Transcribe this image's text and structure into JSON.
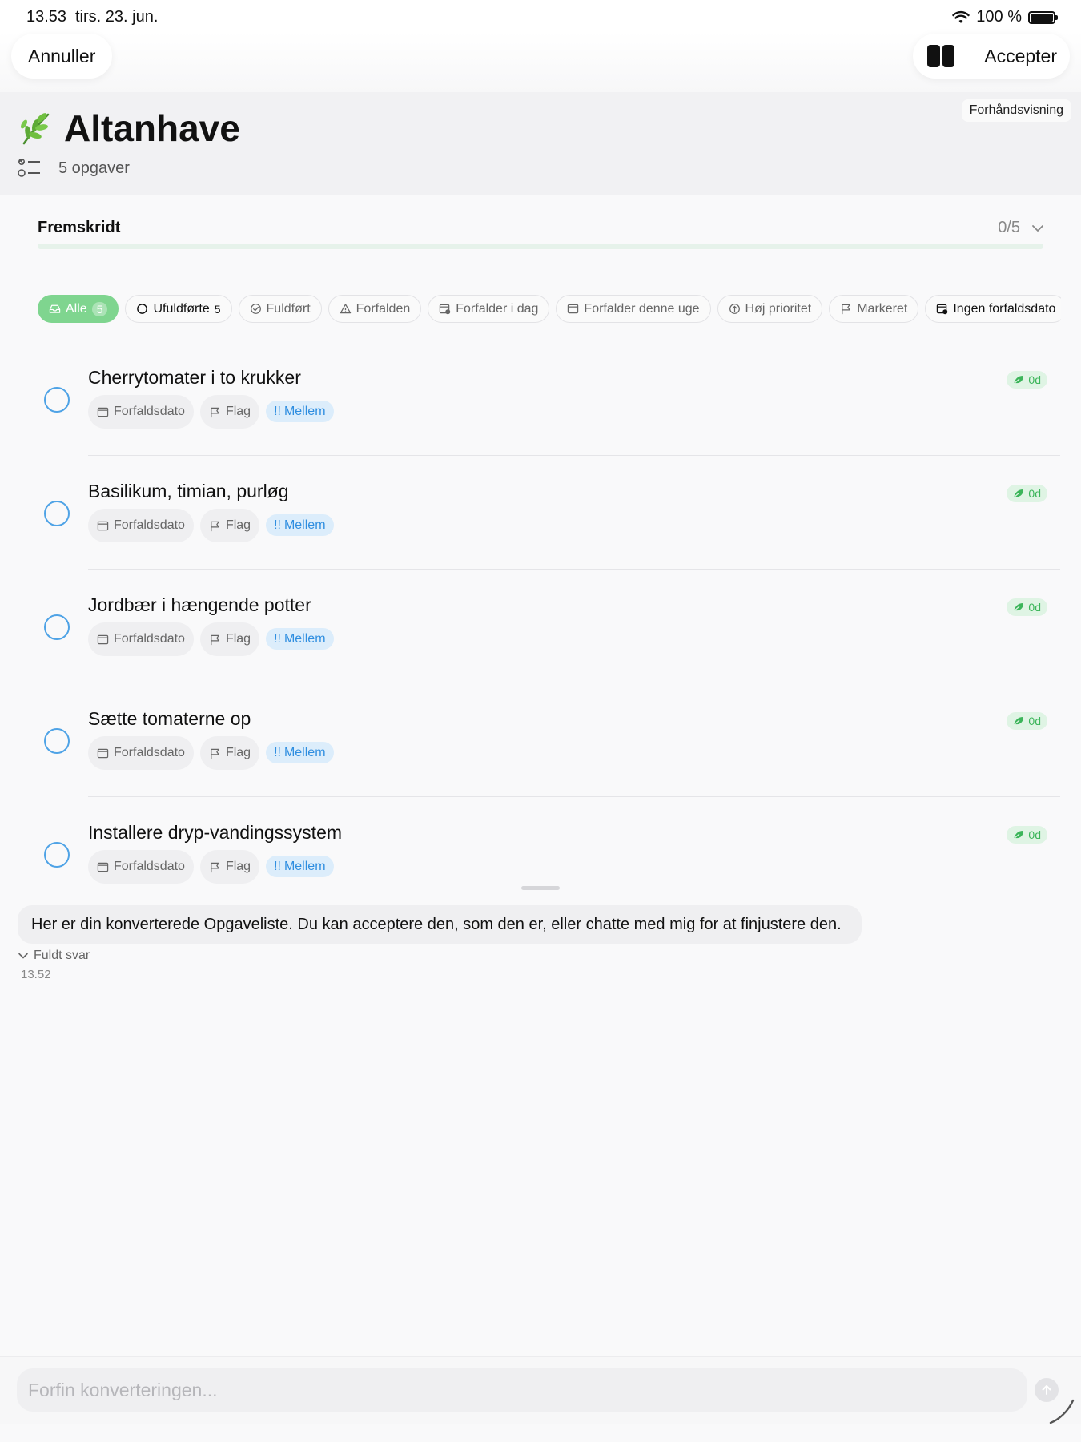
{
  "status_bar": {
    "time": "13.53",
    "date": "tirs. 23. jun.",
    "battery": "100 %"
  },
  "top_bar": {
    "cancel_label": "Annuller",
    "accept_label": "Accepter"
  },
  "header": {
    "preview_badge": "Forhåndsvisning",
    "title": "Altanhave",
    "task_count": "5 opgaver"
  },
  "progress": {
    "label": "Fremskridt",
    "value_text": "0/5",
    "completed": 0,
    "total": 5
  },
  "filters": [
    {
      "label": "Alle",
      "count": "5",
      "icon": "tray-icon",
      "active": true
    },
    {
      "label": "Ufuldførte",
      "count": "5",
      "icon": "circle-icon",
      "active": false
    },
    {
      "label": "Fuldført",
      "count": "",
      "icon": "check-circle-icon",
      "active": false
    },
    {
      "label": "Forfalden",
      "count": "",
      "icon": "warning-icon",
      "active": false
    },
    {
      "label": "Forfalder i dag",
      "count": "",
      "icon": "calendar-clock-icon",
      "active": false
    },
    {
      "label": "Forfalder denne uge",
      "count": "",
      "icon": "calendar-icon",
      "active": false
    },
    {
      "label": "Høj prioritet",
      "count": "",
      "icon": "priority-up-icon",
      "active": false
    },
    {
      "label": "Markeret",
      "count": "",
      "icon": "flag-icon",
      "active": false
    },
    {
      "label": "Ingen forfaldsdato",
      "count": "",
      "icon": "calendar-x-icon",
      "active": false
    }
  ],
  "tasks": [
    {
      "title": "Cherrytomater i to krukker",
      "due_label": "Forfaldsdato",
      "flag_label": "Flag",
      "priority_label": "Mellem",
      "priority_marker": "!!",
      "duration": "0d"
    },
    {
      "title": "Basilikum, timian, purløg",
      "due_label": "Forfaldsdato",
      "flag_label": "Flag",
      "priority_label": "Mellem",
      "priority_marker": "!!",
      "duration": "0d"
    },
    {
      "title": "Jordbær i hængende potter",
      "due_label": "Forfaldsdato",
      "flag_label": "Flag",
      "priority_label": "Mellem",
      "priority_marker": "!!",
      "duration": "0d"
    },
    {
      "title": "Sætte tomaterne op",
      "due_label": "Forfaldsdato",
      "flag_label": "Flag",
      "priority_label": "Mellem",
      "priority_marker": "!!",
      "duration": "0d"
    },
    {
      "title": "Installere dryp-vandingssystem",
      "due_label": "Forfaldsdato",
      "flag_label": "Flag",
      "priority_label": "Mellem",
      "priority_marker": "!!",
      "duration": "0d"
    }
  ],
  "chat": {
    "message": "Her er din konverterede Opgaveliste. Du kan acceptere den, som den er, eller chatte med mig for at finjustere den.",
    "full_answer_label": "Fuldt svar",
    "time": "13.52"
  },
  "input": {
    "placeholder": "Forfin konverteringen..."
  },
  "colors": {
    "accent_green": "#7fd58f",
    "progress_green": "#4cc56a",
    "task_circle_blue": "#4fa3e6",
    "priority_blue": "#2f8ee0"
  }
}
